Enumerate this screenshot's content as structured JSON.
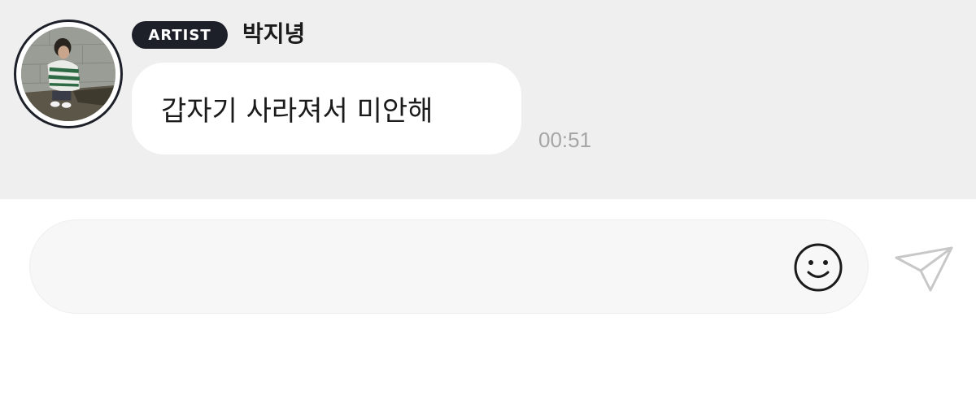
{
  "chat": {
    "sender": {
      "badge": "ARTIST",
      "name": "박지녕",
      "avatar_icon": "profile-photo"
    },
    "message": {
      "text": "갑자기 사라져서 미안해",
      "time": "00:51"
    }
  },
  "composer": {
    "placeholder": "",
    "value": "",
    "emoji_icon": "smiley-face-icon",
    "send_icon": "paper-plane-icon"
  },
  "colors": {
    "chat_background": "#efefef",
    "badge_background": "#1d2029",
    "bubble_background": "#ffffff",
    "timestamp_color": "#a6a6a6",
    "send_icon_color": "#c8c8c8"
  }
}
